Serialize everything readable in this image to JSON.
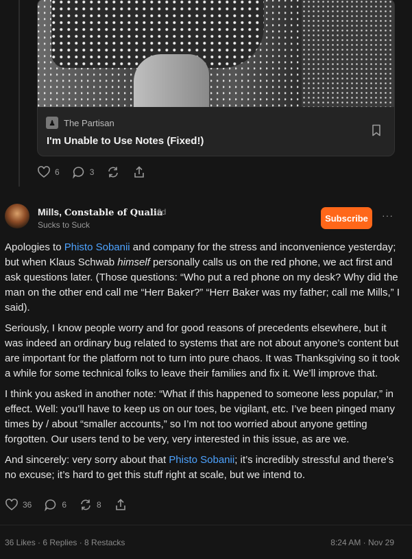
{
  "top_note": {
    "card": {
      "publication": "The Partisan",
      "title": "I'm Unable to Use Notes (Fixed!)"
    },
    "actions": {
      "likes": "6",
      "comments": "3"
    }
  },
  "post": {
    "author_prefix": "Mills, ",
    "author_title": "Constable of Qualia",
    "time": "6d",
    "subtitle": "Sucks to Suck",
    "subscribe_label": "Subscribe",
    "more_label": "···",
    "paragraphs": {
      "p1_a": "Apologies to ",
      "p1_link": "Phisto Sobanii",
      "p1_b": " and company for the stress and inconvenience yesterday; but when Klaus Schwab ",
      "p1_em": "himself",
      "p1_c": " personally calls us on the red phone, we act first and ask questions later. (Those questions: “Who put a red phone on my desk? Why did the man on the other end call me “Herr Baker?” “Herr Baker was my father; call me Mills,” I said).",
      "p2": "Seriously, I know people worry and for good reasons of precedents elsewhere, but it was indeed an ordinary bug related to systems that are not about anyone’s content but are important for the platform not to turn into pure chaos. It was Thanksgiving so it took a while for some technical folks to leave their families and fix it. We’ll improve that.",
      "p3": "I think you asked in another note: “What if this happened to someone less popular,” in effect. Well: you’ll have to keep us on our toes, be vigilant, etc. I’ve been pinged many times by / about “smaller accounts,” so I’m not too worried about anyone getting forgotten. Our users tend to be very, very interested in this issue, as are we.",
      "p4_a": "And sincerely: very sorry about that ",
      "p4_link": "Phisto Sobanii",
      "p4_b": "; it’s incredibly stressful and there’s no excuse; it’s hard to get this stuff right at scale, but we intend to."
    },
    "actions": {
      "likes": "36",
      "comments": "6",
      "restacks": "8"
    },
    "footer": {
      "stats": "36 Likes · 6 Replies · 8 Restacks",
      "timestamp": "8:24 AM · Nov 29"
    }
  },
  "colors": {
    "accent": "#ff6719",
    "link": "#4ea3ff",
    "background": "#151515"
  }
}
